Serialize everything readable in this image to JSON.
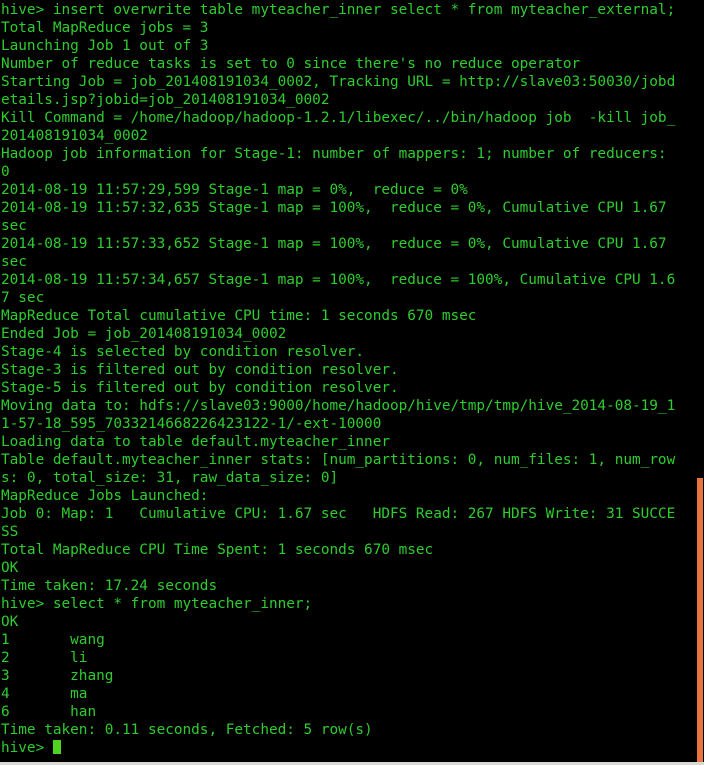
{
  "terminal": {
    "title": "hive CLI session",
    "colors": {
      "background": "#000000",
      "text": "#2fcc2f",
      "cursor": "#4fd41f",
      "scrollbar": "#e8743f",
      "window_edge": "#d8d8d4"
    },
    "prompt": "hive>",
    "cursor_symbol": "block-cursor",
    "columns": 84,
    "rows": 42,
    "lines": [
      "hive> insert overwrite table myteacher_inner select * from myteacher_external;",
      "Total MapReduce jobs = 3",
      "Launching Job 1 out of 3",
      "Number of reduce tasks is set to 0 since there's no reduce operator",
      "Starting Job = job_201408191034_0002, Tracking URL = http://slave03:50030/jobd",
      "etails.jsp?jobid=job_201408191034_0002",
      "Kill Command = /home/hadoop/hadoop-1.2.1/libexec/../bin/hadoop job  -kill job_",
      "201408191034_0002",
      "Hadoop job information for Stage-1: number of mappers: 1; number of reducers:",
      "0",
      "2014-08-19 11:57:29,599 Stage-1 map = 0%,  reduce = 0%",
      "2014-08-19 11:57:32,635 Stage-1 map = 100%,  reduce = 0%, Cumulative CPU 1.67",
      "sec",
      "2014-08-19 11:57:33,652 Stage-1 map = 100%,  reduce = 0%, Cumulative CPU 1.67",
      "sec",
      "2014-08-19 11:57:34,657 Stage-1 map = 100%,  reduce = 100%, Cumulative CPU 1.6",
      "7 sec",
      "MapReduce Total cumulative CPU time: 1 seconds 670 msec",
      "Ended Job = job_201408191034_0002",
      "Stage-4 is selected by condition resolver.",
      "Stage-3 is filtered out by condition resolver.",
      "Stage-5 is filtered out by condition resolver.",
      "Moving data to: hdfs://slave03:9000/home/hadoop/hive/tmp/tmp/hive_2014-08-19_1",
      "1-57-18_595_7033214668226423122-1/-ext-10000",
      "Loading data to table default.myteacher_inner",
      "Table default.myteacher_inner stats: [num_partitions: 0, num_files: 1, num_row",
      "s: 0, total_size: 31, raw_data_size: 0]",
      "MapReduce Jobs Launched:",
      "Job 0: Map: 1   Cumulative CPU: 1.67 sec   HDFS Read: 267 HDFS Write: 31 SUCCE",
      "SS",
      "Total MapReduce CPU Time Spent: 1 seconds 670 msec",
      "OK",
      "Time taken: 17.24 seconds",
      "hive> select * from myteacher_inner;",
      "OK",
      "1\twang",
      "2\tli",
      "3\tzhang",
      "4\tma",
      "6\than",
      "Time taken: 0.11 seconds, Fetched: 5 row(s)"
    ],
    "final_prompt": "hive> ",
    "query_result": {
      "rows": [
        {
          "id": "1",
          "name": "wang"
        },
        {
          "id": "2",
          "name": "li"
        },
        {
          "id": "3",
          "name": "zhang"
        },
        {
          "id": "4",
          "name": "ma"
        },
        {
          "id": "6",
          "name": "han"
        }
      ],
      "fetched_count": "5",
      "time_taken": "0.11 seconds"
    },
    "job_summary": {
      "total_mapreduce_jobs": "3",
      "job_id": "job_201408191034_0002",
      "tracking_url": "http://slave03:50030/jobdetails.jsp?jobid=job_201408191034_0002",
      "mappers": "1",
      "reducers": "0",
      "cumulative_cpu": "1.67 sec",
      "hdfs_read": "267",
      "hdfs_write": "31",
      "status": "SUCCESS",
      "total_cpu_time_spent": "1 seconds 670 msec",
      "insert_time_taken": "17.24 seconds"
    }
  }
}
